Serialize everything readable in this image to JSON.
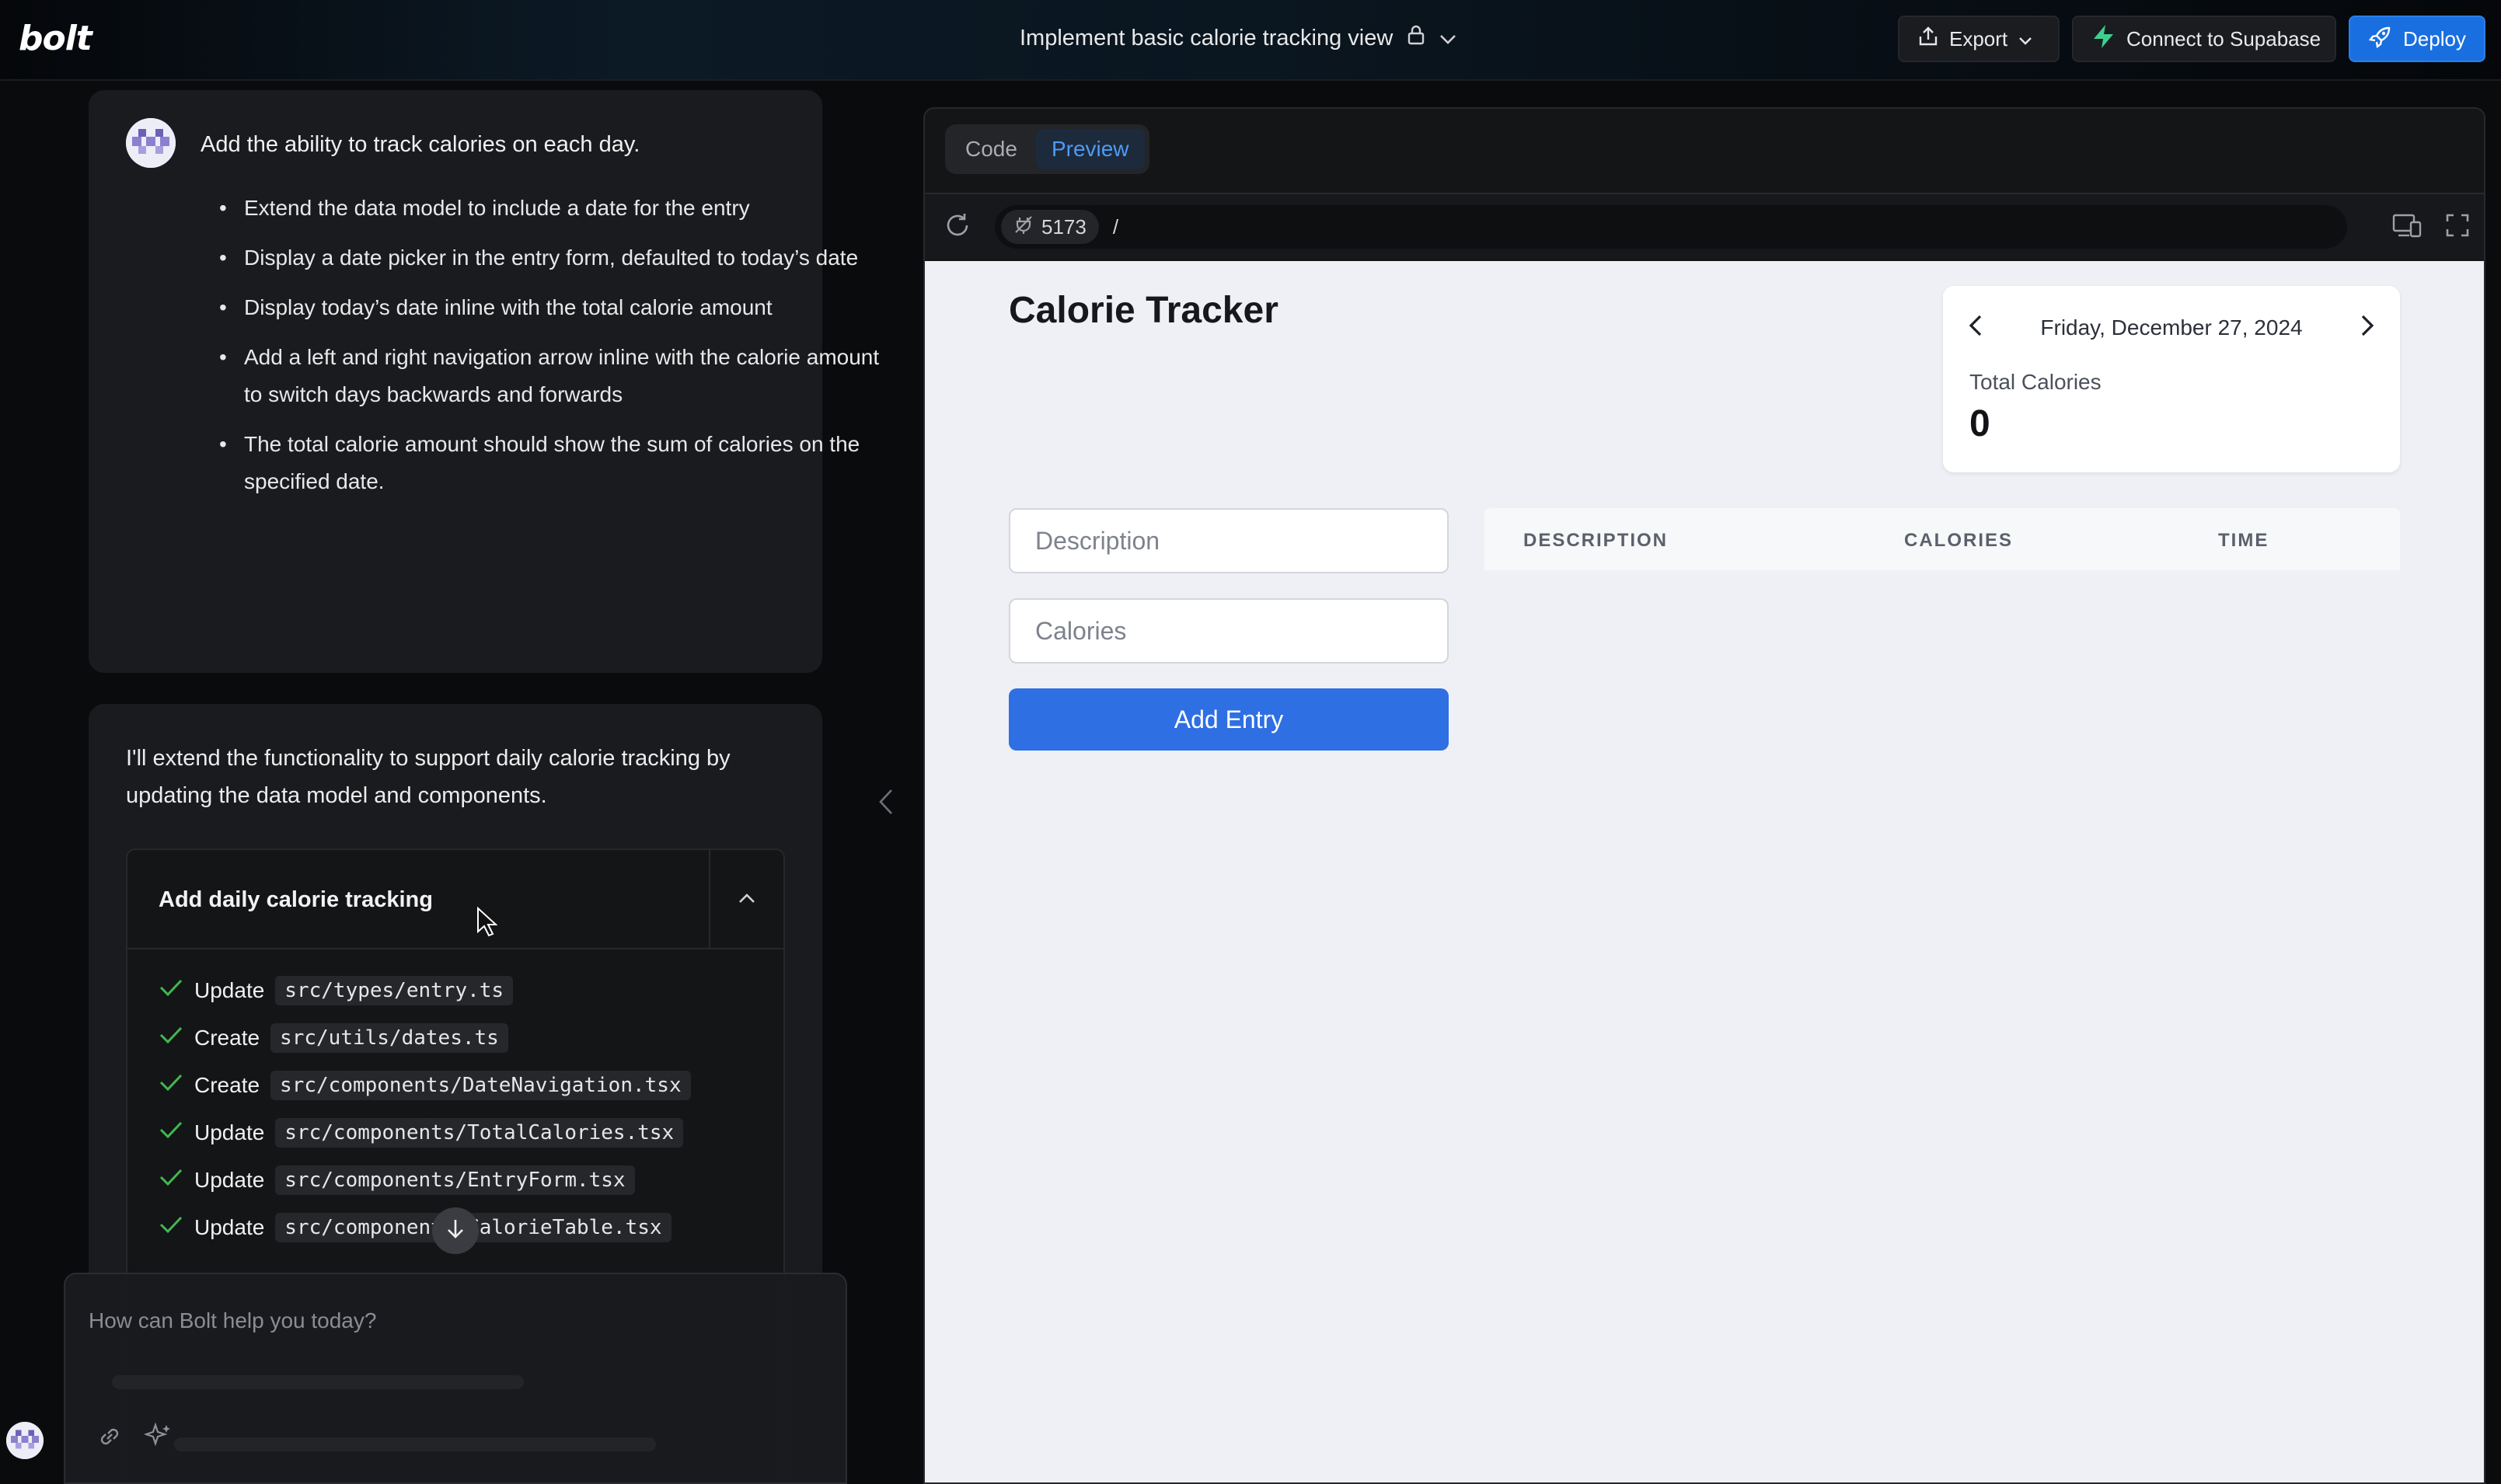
{
  "header": {
    "logo": "bolt",
    "project_title": "Implement basic calorie tracking view",
    "export_label": "Export",
    "supabase_label": "Connect to Supabase",
    "deploy_label": "Deploy"
  },
  "chat": {
    "user_message": {
      "lead": "Add the ability to track calories on each day.",
      "bullets": [
        "Extend the data model to include a date for the entry",
        "Display a date picker in the entry form, defaulted to today’s date",
        "Display today’s date inline with the total calorie amount",
        "Add a left and right navigation arrow inline with the calorie amount to switch days backwards and forwards",
        "The total calorie amount should show the sum of calories on the specified date."
      ]
    },
    "assistant_message": {
      "intro": "I'll extend the functionality to support daily calorie tracking by updating the data model and components.",
      "artifact_title": "Add daily calorie tracking",
      "steps": [
        {
          "action": "Update",
          "file": "src/types/entry.ts"
        },
        {
          "action": "Create",
          "file": "src/utils/dates.ts"
        },
        {
          "action": "Create",
          "file": "src/components/DateNavigation.tsx"
        },
        {
          "action": "Update",
          "file": "src/components/TotalCalories.tsx"
        },
        {
          "action": "Update",
          "file": "src/components/EntryForm.tsx"
        },
        {
          "action": "Update",
          "file": "src/components/CalorieTable.tsx"
        }
      ]
    },
    "prompt_placeholder": "How can Bolt help you today?"
  },
  "workbench": {
    "tabs": [
      {
        "label": "Code",
        "active": false
      },
      {
        "label": "Preview",
        "active": true
      }
    ],
    "port": "5173",
    "path": "/"
  },
  "preview_app": {
    "title": "Calorie Tracker",
    "date": "Friday, December 27, 2024",
    "total_label": "Total Calories",
    "total_value": "0",
    "description_placeholder": "Description",
    "calories_placeholder": "Calories",
    "add_button": "Add Entry",
    "columns": [
      "DESCRIPTION",
      "CALORIES",
      "TIME"
    ]
  },
  "colors": {
    "accent": "#1a6fe0",
    "check": "#3fb950",
    "add_button": "#2f6fe4"
  }
}
